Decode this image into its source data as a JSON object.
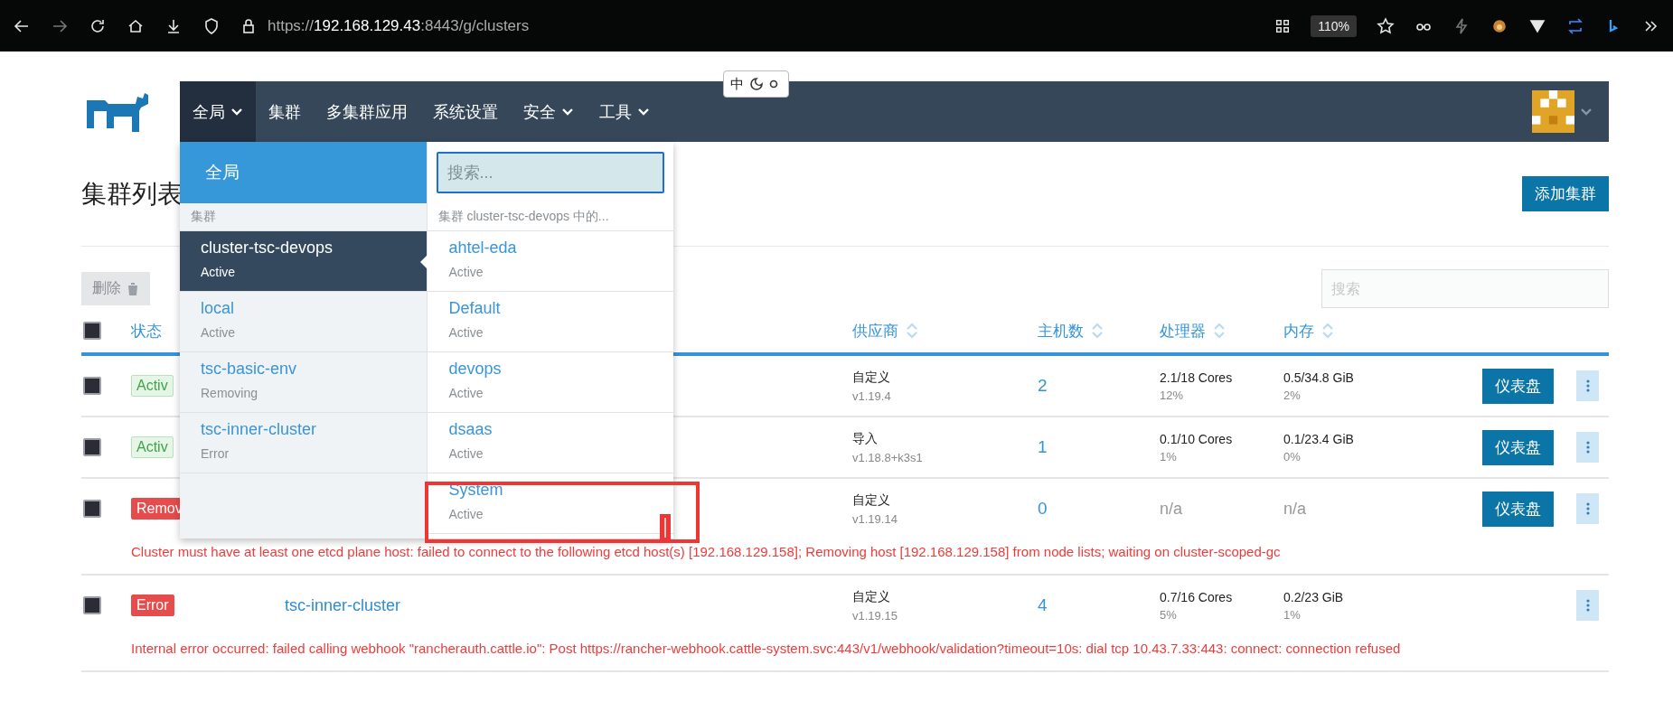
{
  "browser": {
    "url_scheme": "https://",
    "url_host": "192.168.129.43",
    "url_rest": ":8443/g/clusters",
    "zoom": "110%"
  },
  "ime": {
    "label": "中"
  },
  "nav": {
    "items": [
      {
        "label": "全局",
        "dropdown": true,
        "selected": true
      },
      {
        "label": "集群",
        "dropdown": false,
        "selected": false
      },
      {
        "label": "多集群应用",
        "dropdown": false,
        "selected": false
      },
      {
        "label": "系统设置",
        "dropdown": false,
        "selected": false
      },
      {
        "label": "安全",
        "dropdown": true,
        "selected": false
      },
      {
        "label": "工具",
        "dropdown": true,
        "selected": false
      }
    ]
  },
  "page": {
    "title": "集群列表",
    "add_button": "添加集群",
    "delete_button": "删除",
    "search_placeholder": "搜索"
  },
  "table": {
    "select_all_checked": false,
    "columns": [
      {
        "label": "状态",
        "sortable": false
      },
      {
        "label": "供应商",
        "sortable": true
      },
      {
        "label": "主机数",
        "sortable": true
      },
      {
        "label": "处理器",
        "sortable": true
      },
      {
        "label": "内存",
        "sortable": true
      }
    ],
    "rows": [
      {
        "checked": false,
        "state": "Activ",
        "kind": "active",
        "provider": "自定义",
        "version": "v1.19.4",
        "hosts": "2",
        "cpu": "2.1/18 Cores",
        "cpu_pct": "12%",
        "memory": "0.5/34.8 GiB",
        "memory_pct": "2%",
        "dashboard": "仪表盘"
      },
      {
        "checked": false,
        "state": "Activ",
        "kind": "active",
        "provider": "导入",
        "version": "v1.18.8+k3s1",
        "hosts": "1",
        "cpu": "0.1/10 Cores",
        "cpu_pct": "1%",
        "memory": "0.1/23.4 GiB",
        "memory_pct": "0%",
        "dashboard": "仪表盘"
      },
      {
        "checked": false,
        "state": "Remov",
        "kind": "error",
        "provider": "自定义",
        "version": "v1.19.14",
        "hosts": "0",
        "cpu": "n/a",
        "memory": "n/a",
        "dashboard": "仪表盘",
        "message": "Cluster must have at least one etcd plane host: failed to connect to the following etcd host(s) [192.168.129.158]; Removing host [192.168.129.158] from node lists; waiting on cluster-scoped-gc"
      },
      {
        "checked": false,
        "state": "Error",
        "kind": "error",
        "name": "tsc-inner-cluster",
        "provider": "自定义",
        "version": "v1.19.15",
        "hosts": "4",
        "cpu": "0.7/16 Cores",
        "cpu_pct": "5%",
        "memory": "0.2/23 GiB",
        "memory_pct": "1%",
        "message": "Internal error occurred: failed calling webhook \"rancherauth.cattle.io\": Post https://rancher-webhook.cattle-system.svc:443/v1/webhook/validation?timeout=10s: dial tcp 10.43.7.33:443: connect: connection refused"
      }
    ]
  },
  "dropdown": {
    "global_label": "全局",
    "clusters_header": "集群",
    "search_placeholder": "搜索...",
    "projects_header": "集群 cluster-tsc-devops 中的...",
    "clusters": [
      {
        "name": "cluster-tsc-devops",
        "status": "Active",
        "selected": true
      },
      {
        "name": "local",
        "status": "Active",
        "selected": false
      },
      {
        "name": "tsc-basic-env",
        "status": "Removing",
        "selected": false
      },
      {
        "name": "tsc-inner-cluster",
        "status": "Error",
        "selected": false
      }
    ],
    "projects": [
      {
        "name": "ahtel-eda",
        "status": "Active"
      },
      {
        "name": "Default",
        "status": "Active"
      },
      {
        "name": "devops",
        "status": "Active"
      },
      {
        "name": "dsaas",
        "status": "Active"
      },
      {
        "name": "System",
        "status": "Active"
      }
    ]
  }
}
